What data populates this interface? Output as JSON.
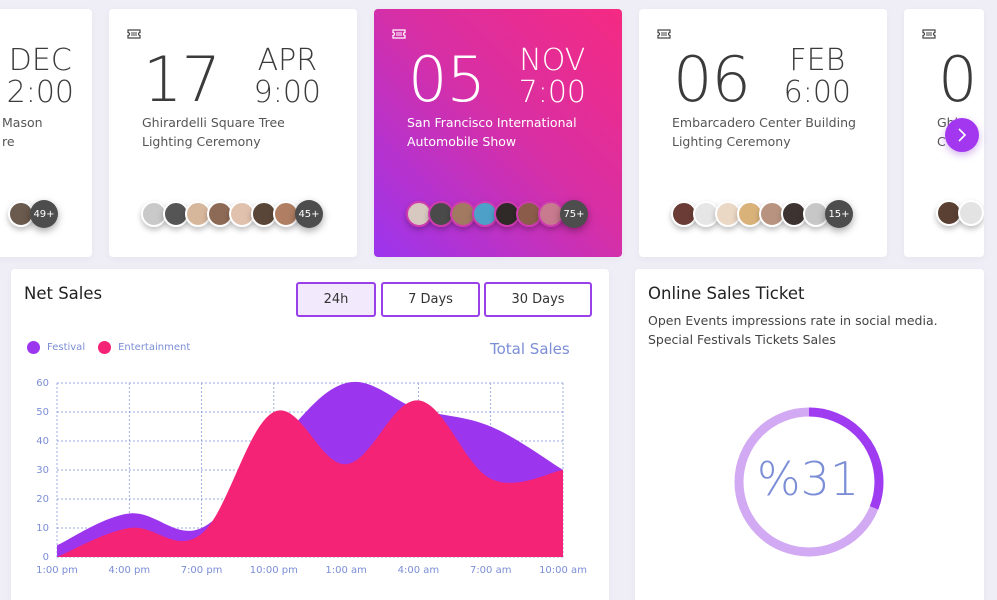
{
  "events": [
    {
      "day": "",
      "month": "DEC",
      "time": "2:00",
      "title": "Mason ...re",
      "more": "49+"
    },
    {
      "day": "17",
      "month": "APR",
      "time": "9:00",
      "title": "Ghirardelli Square Tree Lighting Ceremony",
      "more": "45+"
    },
    {
      "day": "05",
      "month": "NOV",
      "time": "7:00",
      "title": "San Francisco International Automobile Show",
      "more": "75+"
    },
    {
      "day": "06",
      "month": "FEB",
      "time": "6:00",
      "title": "Embarcadero Center Building Lighting Ceremony",
      "more": "15+"
    },
    {
      "day": "0",
      "month": "",
      "time": "",
      "title": "Ghi... C...",
      "more": ""
    }
  ],
  "net_sales": {
    "title": "Net Sales",
    "ranges": [
      "24h",
      "7 Days",
      "30 Days"
    ],
    "selected_range": "24h",
    "total_label": "Total Sales"
  },
  "online": {
    "title": "Online Sales Ticket",
    "desc": "Open Events impressions rate in social media. Special Festivals Tickets Sales",
    "percent_label": "%31",
    "percent_value": 31
  },
  "colors": {
    "purple": "#9b35ee",
    "pink": "#f52376",
    "axis": "#7b8ed6"
  },
  "chart_data": {
    "type": "area",
    "x": [
      "1:00 pm",
      "4:00 pm",
      "7:00 pm",
      "10:00 pm",
      "1:00 am",
      "4:00 am",
      "7:00 am",
      "10:00 am"
    ],
    "ylim": [
      0,
      60
    ],
    "yticks": [
      0,
      10,
      20,
      30,
      40,
      50,
      60
    ],
    "grid": true,
    "legend_position": "top-left",
    "series": [
      {
        "name": "Festival",
        "color": "#9b35ee",
        "values": [
          4,
          15,
          10,
          38,
          60,
          51,
          45,
          30
        ]
      },
      {
        "name": "Entertainment",
        "color": "#f52376",
        "values": [
          0,
          10,
          8,
          50,
          32,
          54,
          27,
          30
        ]
      }
    ]
  }
}
